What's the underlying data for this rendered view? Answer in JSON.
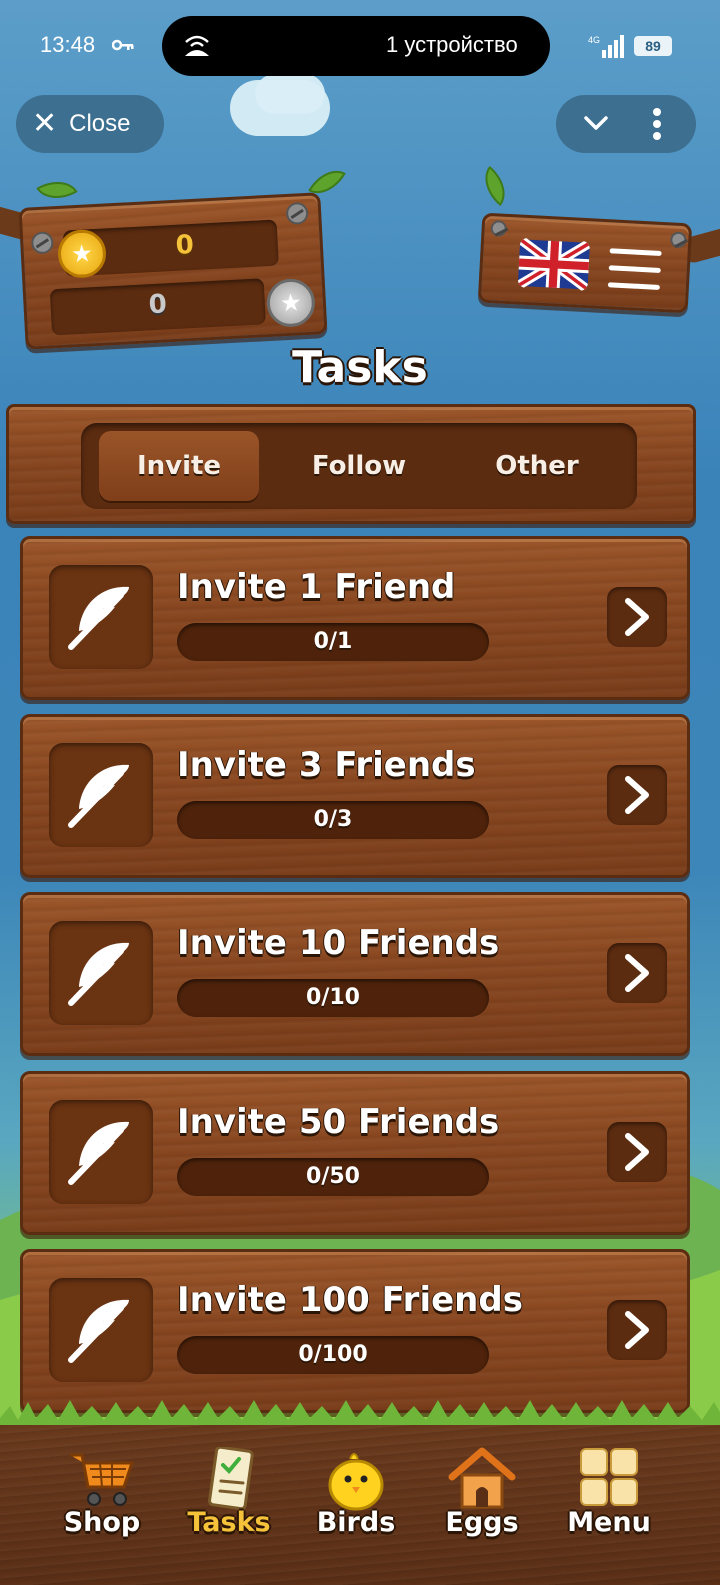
{
  "status_bar": {
    "time": "13:48",
    "island_text": "1 устройство",
    "network": "4G",
    "battery": "89"
  },
  "telegram": {
    "close_label": "Close"
  },
  "balance": {
    "gold": "0",
    "silver": "0"
  },
  "page_title": "Tasks",
  "tabs": [
    {
      "label": "Invite",
      "active": true
    },
    {
      "label": "Follow",
      "active": false
    },
    {
      "label": "Other",
      "active": false
    }
  ],
  "tasks": [
    {
      "title": "Invite 1 Friend",
      "progress": "0/1",
      "icon": "feather-icon"
    },
    {
      "title": "Invite 3 Friends",
      "progress": "0/3",
      "icon": "feather-icon"
    },
    {
      "title": "Invite 10 Friends",
      "progress": "0/10",
      "icon": "feather-icon"
    },
    {
      "title": "Invite 50 Friends",
      "progress": "0/50",
      "icon": "feather-icon"
    },
    {
      "title": "Invite 100 Friends",
      "progress": "0/100",
      "icon": "feather-icon"
    }
  ],
  "nav": [
    {
      "label": "Shop",
      "icon": "cart-icon",
      "active": false
    },
    {
      "label": "Tasks",
      "icon": "tasks-clipboard-icon",
      "active": true
    },
    {
      "label": "Birds",
      "icon": "chick-icon",
      "active": false
    },
    {
      "label": "Eggs",
      "icon": "house-icon",
      "active": false
    },
    {
      "label": "Menu",
      "icon": "grid-icon",
      "active": false
    }
  ],
  "colors": {
    "gold": "#f6c23a",
    "wood": "#87461f",
    "wood_dark": "#5c2c10",
    "sky": "#3a83b9"
  }
}
